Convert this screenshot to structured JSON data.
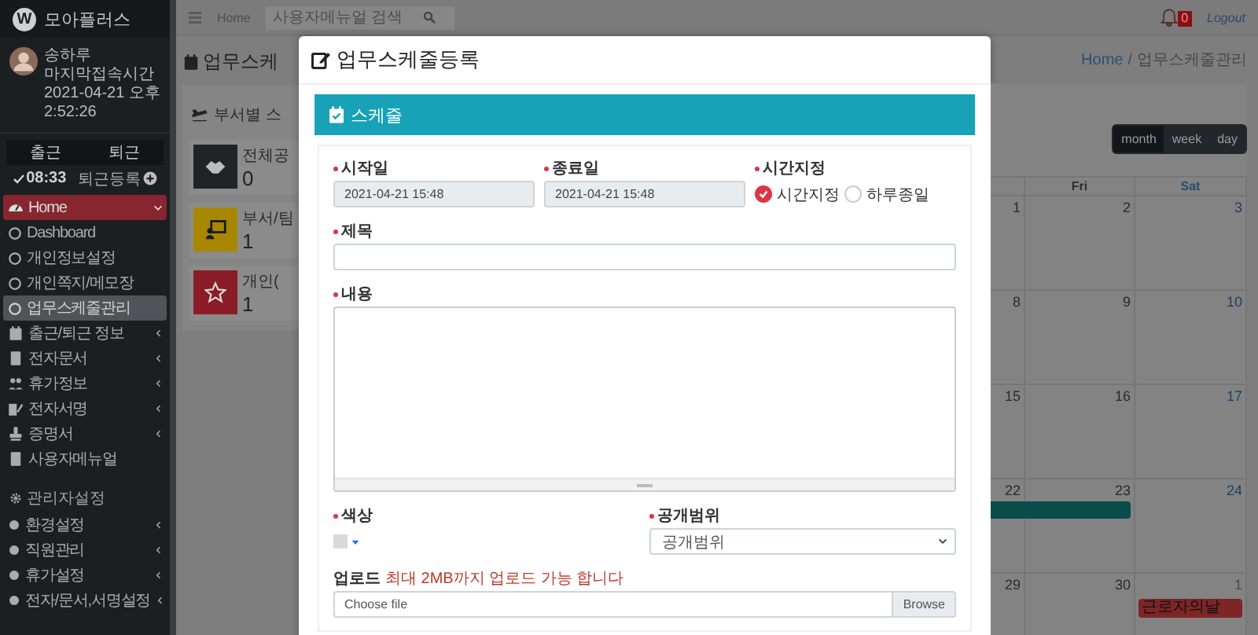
{
  "sidebar": {
    "logo": {
      "letter": "W",
      "title": "모아플러스"
    },
    "user": {
      "name": "송하루",
      "label": "마지막접속시간",
      "time": "2021-04-21 오후 2:52:26"
    },
    "attendance": {
      "tabs": [
        {
          "label": "출근"
        },
        {
          "label": "퇴근"
        }
      ],
      "clock_in": "08:33",
      "action": "퇴근등록"
    },
    "menu": [
      {
        "kind": "group",
        "label": "Home",
        "selected": true,
        "expanded": true,
        "children": [
          {
            "label": "Dashboard",
            "selected": false
          },
          {
            "label": "개인정보설정",
            "selected": false
          },
          {
            "label": "개인쪽지/메모장",
            "selected": false
          },
          {
            "label": "업무스케줄관리",
            "selected": true
          }
        ]
      },
      {
        "kind": "group",
        "label": "출근/퇴근 정보",
        "selected": false,
        "expanded": false
      },
      {
        "kind": "group",
        "label": "전자문서",
        "selected": false,
        "expanded": false
      },
      {
        "kind": "group",
        "label": "휴가정보",
        "selected": false,
        "expanded": false
      },
      {
        "kind": "group",
        "label": "전자서명",
        "selected": false,
        "expanded": false
      },
      {
        "kind": "group",
        "label": "증명서",
        "selected": false,
        "expanded": false
      },
      {
        "kind": "link",
        "label": "사용자메뉴얼",
        "selected": false
      }
    ],
    "admin": {
      "title": "관리자설정",
      "items": [
        {
          "label": "환경설정",
          "expanded": false
        },
        {
          "label": "직원관리",
          "expanded": false
        },
        {
          "label": "휴가설정",
          "expanded": false
        },
        {
          "label": "전자/문서,서명설정",
          "expanded": false
        }
      ]
    }
  },
  "topbar": {
    "home": "Home",
    "search": {
      "placeholder": "사용자메뉴얼 검색"
    },
    "notifications": "0",
    "logout": "Logout"
  },
  "page": {
    "title": "업무스케",
    "section": "부서별 스",
    "stats": [
      {
        "label": "전체공",
        "count": "0",
        "color": "#222324"
      },
      {
        "label": "부서/팀",
        "count": "1",
        "color": "#a88700"
      },
      {
        "label": "개인(",
        "count": "1",
        "color": "#8a1c25"
      }
    ]
  },
  "breadcrumb": {
    "separator": "/",
    "items": [
      {
        "label": "Home",
        "link": true
      },
      {
        "label": "업무스케줄관리",
        "link": false
      }
    ]
  },
  "calendar": {
    "views": [
      {
        "label": "month",
        "selected": true
      },
      {
        "label": "week",
        "selected": false
      },
      {
        "label": "day",
        "selected": false
      }
    ],
    "columns": [
      {
        "weekend": false
      },
      {
        "label": "Fri",
        "weekend": false
      },
      {
        "label": "Sat",
        "weekend": true
      }
    ],
    "weeks": [
      {
        "days": [
          {
            "number": "1",
            "muted": false
          },
          {
            "number": "2",
            "muted": false
          },
          {
            "number": "3",
            "muted": false
          }
        ]
      },
      {
        "days": [
          {
            "number": "8",
            "muted": false
          },
          {
            "number": "9",
            "muted": false
          },
          {
            "number": "10",
            "muted": false
          }
        ]
      },
      {
        "days": [
          {
            "number": "15",
            "muted": false
          },
          {
            "number": "16",
            "muted": false
          },
          {
            "number": "17",
            "muted": false
          }
        ]
      },
      {
        "days": [
          {
            "number": "22",
            "muted": false,
            "events": [
              {
                "kind": "middle",
                "color": "#0b4d4a"
              }
            ]
          },
          {
            "number": "23",
            "muted": false,
            "events": [
              {
                "kind": "end",
                "color": "#0b4d4a"
              }
            ]
          },
          {
            "number": "24",
            "muted": false
          }
        ]
      },
      {
        "days": [
          {
            "number": "29",
            "muted": false
          },
          {
            "number": "30",
            "muted": false
          },
          {
            "number": "1",
            "muted": true,
            "events": [
              {
                "kind": "single",
                "color": "#7e2526",
                "title": "근로자의날"
              }
            ]
          }
        ]
      }
    ]
  },
  "modal": {
    "title": "업무스케줄등록",
    "section": "스케줄",
    "start": {
      "label": "시작일",
      "required": true,
      "value": "2021-04-21 15:48"
    },
    "end": {
      "label": "종료일",
      "required": true,
      "value": "2021-04-21 15:48"
    },
    "time_mode": {
      "label": "시간지정",
      "required": true,
      "options": [
        {
          "label": "시간지정",
          "selected": true
        },
        {
          "label": "하루종일",
          "selected": false
        }
      ]
    },
    "subject": {
      "label": "제목",
      "required": true
    },
    "content": {
      "label": "내용",
      "required": true
    },
    "color": {
      "label": "색상",
      "required": true
    },
    "visibility": {
      "label": "공개범위",
      "required": true,
      "value": "공개범위"
    },
    "upload": {
      "label": "업로드",
      "note": "최대 2MB까지 업로드 가능 합니다",
      "placeholder": "Choose file",
      "button": "Browse"
    }
  }
}
